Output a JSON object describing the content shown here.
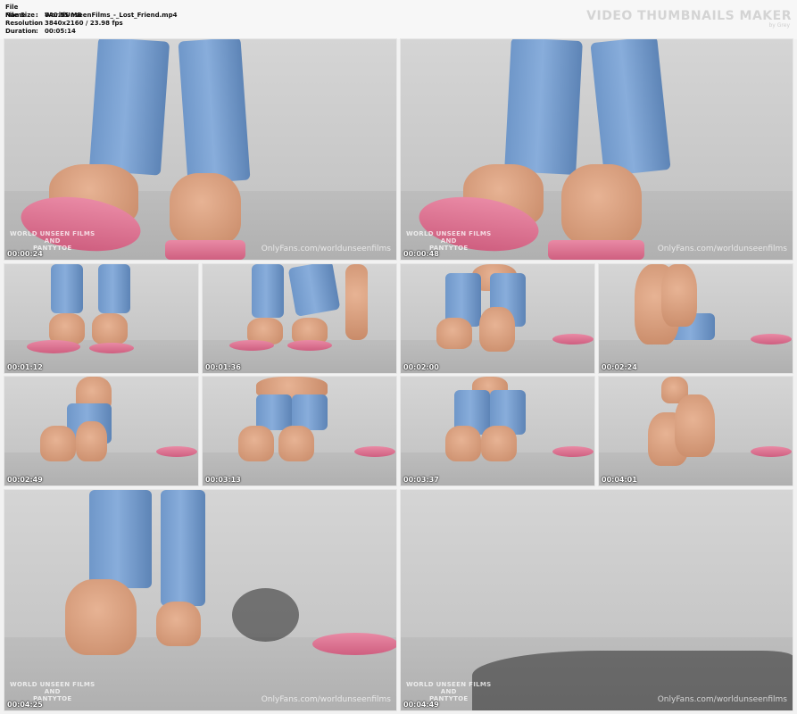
{
  "header": {
    "file_name_label": "File Name",
    "file_name_value": "WorldUnseenFilms_-_Lost_Friend.mp4",
    "file_size_label": "File Size",
    "file_size_value": "840.55 MB",
    "resolution_label": "Resolution",
    "resolution_value": "3840x2160 / 23.98 fps",
    "duration_label": "Duration",
    "duration_value": "00:05:14",
    "separator": ":",
    "brand": "VIDEO THUMBNAILS MAKER",
    "brand_sub": "by Grey"
  },
  "watermark": {
    "logo_line1": "WORLD UNSEEN FILMS",
    "logo_line2": "AND",
    "logo_line3": "PANTYTOE",
    "url": "OnlyFans.com/worldunseenfilms"
  },
  "thumbnails": [
    {
      "timestamp": "00:00:24"
    },
    {
      "timestamp": "00:00:48"
    },
    {
      "timestamp": "00:01:12"
    },
    {
      "timestamp": "00:01:36"
    },
    {
      "timestamp": "00:02:00"
    },
    {
      "timestamp": "00:02:24"
    },
    {
      "timestamp": "00:02:49"
    },
    {
      "timestamp": "00:03:13"
    },
    {
      "timestamp": "00:03:37"
    },
    {
      "timestamp": "00:04:01"
    },
    {
      "timestamp": "00:04:25"
    },
    {
      "timestamp": "00:04:49"
    }
  ]
}
